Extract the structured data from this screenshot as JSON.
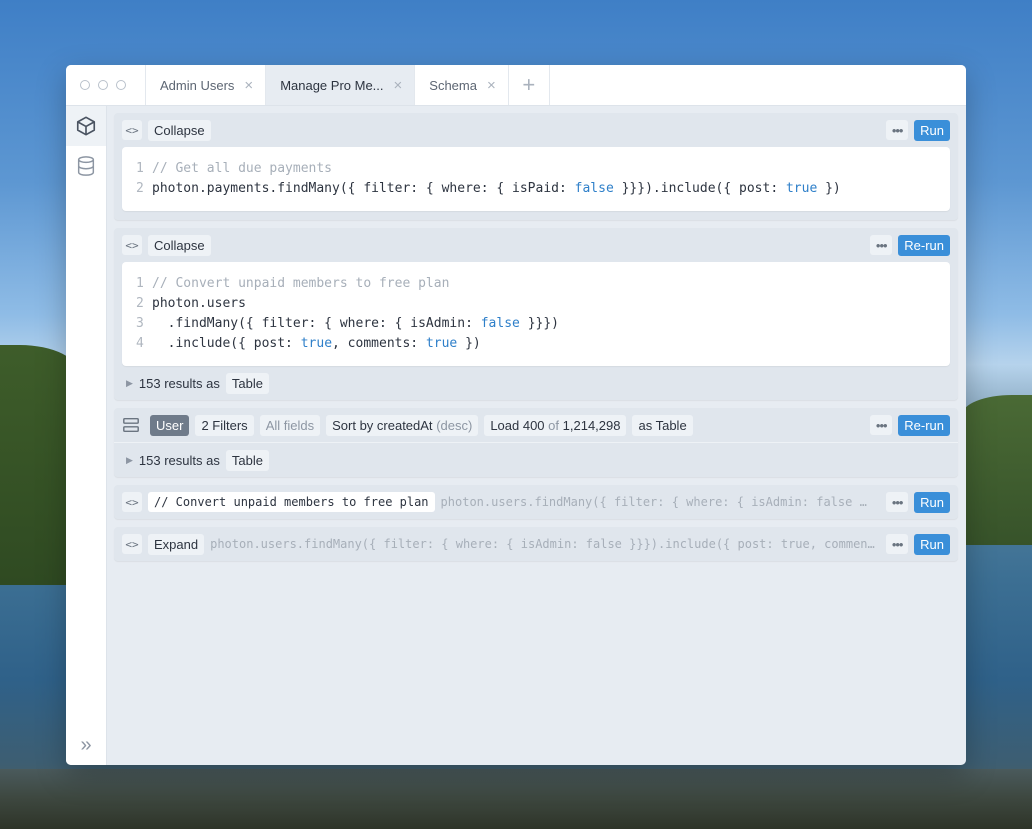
{
  "tabs": [
    {
      "label": "Admin Users"
    },
    {
      "label": "Manage Pro Me..."
    },
    {
      "label": "Schema"
    }
  ],
  "tab_close": "×",
  "tab_add": "+",
  "cards": {
    "c1": {
      "toggle": "Collapse",
      "run": "Run",
      "lines": [
        {
          "n": "1",
          "comment": "// Get all due payments"
        },
        {
          "n": "2",
          "a": "photon.payments.findMany({ filter: { where: { isPaid: ",
          "k1": "false",
          "b": " }}}).include({ post: ",
          "k2": "true",
          "c": " })"
        }
      ]
    },
    "c2": {
      "toggle": "Collapse",
      "run": "Re-run",
      "lines": [
        {
          "n": "1",
          "comment": "// Convert unpaid members to free plan"
        },
        {
          "n": "2",
          "a": "photon.users"
        },
        {
          "n": "3",
          "a": "  .findMany({ filter: { where: { isAdmin: ",
          "k1": "false",
          "b": " }}})"
        },
        {
          "n": "4",
          "a": "  .include({ post: ",
          "k1": "true",
          "b": ", comments: ",
          "k2": "true",
          "c": " })"
        }
      ],
      "results": "153 results as",
      "results_view": "Table"
    },
    "c3": {
      "model": "User",
      "filters": "2 Filters",
      "fields": "All fields",
      "sort": "Sort by createdAt",
      "sort_dir": "(desc)",
      "load": "Load 400",
      "load_of": "of",
      "load_total": "1,214,298",
      "as": "as Table",
      "run": "Re-run",
      "results": "153 results as",
      "results_view": "Table"
    },
    "c4": {
      "title": "// Convert unpaid members to free plan",
      "preview": "photon.users.findMany({ filter: { where: { isAdmin: false …",
      "run": "Run"
    },
    "c5": {
      "toggle": "Expand",
      "preview": "photon.users.findMany({ filter: { where: { isAdmin: false }}}).include({ post: true, commen…",
      "run": "Run"
    }
  },
  "icons": {
    "code": "<>",
    "dots": "•••",
    "triangle": "▶",
    "expand": "»"
  },
  "colors": {
    "accent": "#3a8fd9",
    "keyword": "#2e7fc9"
  }
}
